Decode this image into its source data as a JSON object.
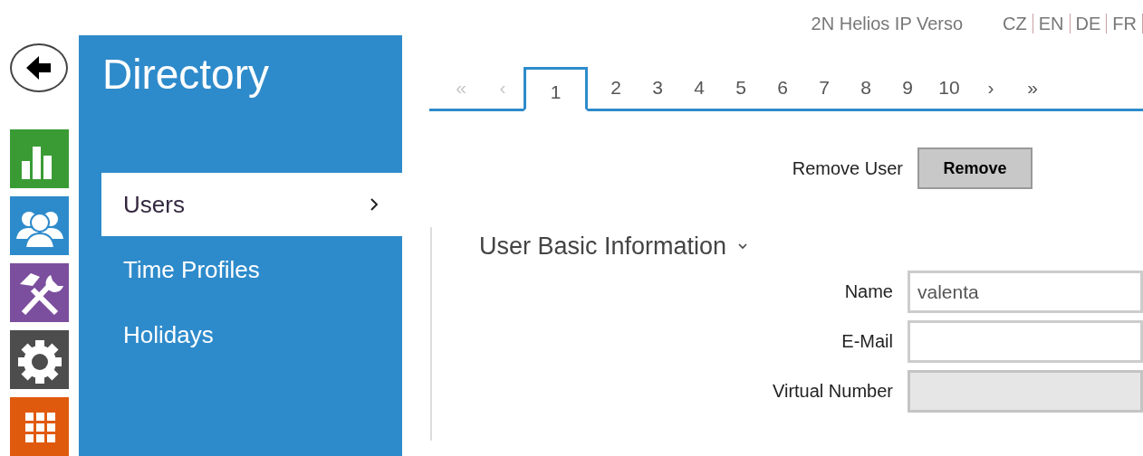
{
  "header": {
    "product": "2N Helios IP Verso",
    "languages": [
      "CZ",
      "EN",
      "DE",
      "FR"
    ]
  },
  "nav_tiles": [
    {
      "kind": "chart",
      "color": "#3a9b35"
    },
    {
      "kind": "users",
      "color": "#2e8bcb"
    },
    {
      "kind": "tools",
      "color": "#7b4f9e"
    },
    {
      "kind": "gear",
      "color": "#4d4d4d"
    },
    {
      "kind": "grid",
      "color": "#e05a0e"
    }
  ],
  "sidebar": {
    "title": "Directory",
    "items": [
      {
        "label": "Users",
        "selected": true
      },
      {
        "label": "Time Profiles",
        "selected": false
      },
      {
        "label": "Holidays",
        "selected": false
      }
    ]
  },
  "pager": [
    {
      "label": "«",
      "selected": false,
      "disabled": true
    },
    {
      "label": "‹",
      "selected": false,
      "disabled": true
    },
    {
      "label": "1",
      "selected": true,
      "disabled": false
    },
    {
      "label": "2",
      "selected": false,
      "disabled": false
    },
    {
      "label": "3",
      "selected": false,
      "disabled": false
    },
    {
      "label": "4",
      "selected": false,
      "disabled": false
    },
    {
      "label": "5",
      "selected": false,
      "disabled": false
    },
    {
      "label": "6",
      "selected": false,
      "disabled": false
    },
    {
      "label": "7",
      "selected": false,
      "disabled": false
    },
    {
      "label": "8",
      "selected": false,
      "disabled": false
    },
    {
      "label": "9",
      "selected": false,
      "disabled": false
    },
    {
      "label": "10",
      "selected": false,
      "disabled": false
    },
    {
      "label": "›",
      "selected": false,
      "disabled": false
    },
    {
      "label": "»",
      "selected": false,
      "disabled": false
    }
  ],
  "remove": {
    "label": "Remove User",
    "button": "Remove"
  },
  "section": {
    "title": "User Basic Information",
    "expanded": true,
    "fields": [
      {
        "label": "Name",
        "value": "valenta",
        "disabled": false
      },
      {
        "label": "E-Mail",
        "disabled": false
      },
      {
        "label": "Virtual Number",
        "disabled": true
      }
    ]
  }
}
